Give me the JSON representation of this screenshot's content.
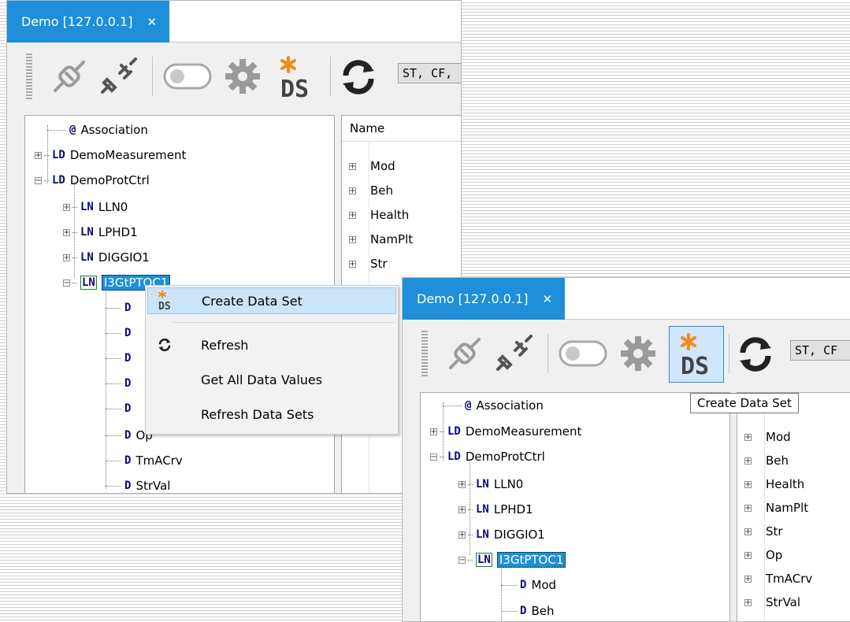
{
  "window": {
    "tab_title": "Demo [127.0.0.1]",
    "close_glyph": "✕"
  },
  "toolbar": {
    "buttons": [
      {
        "name": "connect-plug-icon",
        "label": "Connect"
      },
      {
        "name": "disconnect-plug-icon",
        "label": "Disconnect"
      },
      {
        "name": "toggle-switch-icon",
        "label": "Toggle"
      },
      {
        "name": "gear-icon",
        "label": "Settings"
      },
      {
        "name": "create-dataset-icon",
        "label": "Create Data Set"
      },
      {
        "name": "refresh-icon",
        "label": "Refresh"
      }
    ],
    "fc_filter_left": "ST, CF,",
    "fc_filter_right": "ST, CF",
    "tooltip": "Create Data Set"
  },
  "tree": {
    "association": {
      "kind": "@",
      "label": "Association"
    },
    "ld1": {
      "kind": "LD",
      "label": "DemoMeasurement"
    },
    "ld2": {
      "kind": "LD",
      "label": "DemoProtCtrl"
    },
    "ln": [
      {
        "kind": "LN",
        "label": "LLN0"
      },
      {
        "kind": "LN",
        "label": "LPHD1"
      },
      {
        "kind": "LN",
        "label": "DIGGIO1"
      },
      {
        "kind": "LN",
        "label": "I3GtPTOC1"
      }
    ],
    "do_kind": "D",
    "do_left": [
      "",
      "",
      "",
      "",
      "",
      "Op",
      "TmACrv",
      "StrVal"
    ],
    "do_right": [
      "Mod",
      "Beh"
    ]
  },
  "grid": {
    "header": "Name",
    "rows_left": [
      "Mod",
      "Beh",
      "Health",
      "NamPlt",
      "Str"
    ],
    "rows_right": [
      "Mod",
      "Beh",
      "Health",
      "NamPlt",
      "Str",
      "Op",
      "TmACrv",
      "StrVal"
    ]
  },
  "context_menu": {
    "items": [
      {
        "label": "Create Data Set",
        "icon": "create-dataset-icon"
      },
      {
        "label": "Refresh",
        "icon": "refresh-icon"
      },
      {
        "label": "Get All Data Values",
        "icon": ""
      },
      {
        "label": "Refresh Data Sets",
        "icon": ""
      }
    ]
  },
  "colors": {
    "accent": "#1e8fd8",
    "selection_border": "#0b8a2a",
    "star": "#f08c1a"
  }
}
